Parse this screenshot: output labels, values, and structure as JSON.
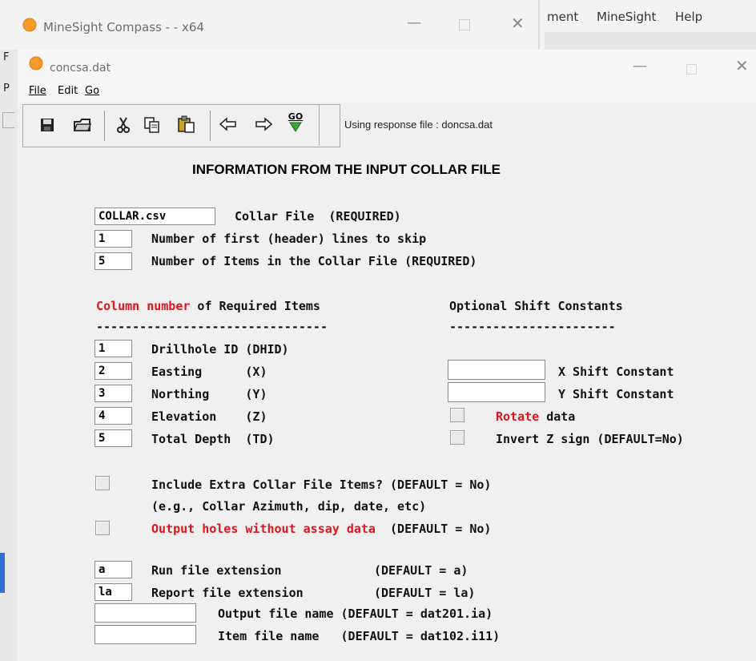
{
  "outer_window": {
    "title": "MineSight Compass - - x64",
    "menu": [
      "ment",
      "MineSight",
      "Help"
    ],
    "left_letters": [
      "F",
      "P"
    ]
  },
  "inner_window": {
    "title": "concsa.dat",
    "menu": [
      "File",
      "Edit",
      "Go"
    ]
  },
  "toolbar": {
    "icons": [
      "save-icon",
      "open-icon",
      "cut-icon",
      "copy-icon",
      "paste-icon",
      "back-arrow-icon",
      "forward-arrow-icon",
      "go-icon"
    ],
    "go_label": "GO",
    "status": "Using response file : doncsa.dat"
  },
  "form": {
    "title": "INFORMATION FROM THE INPUT COLLAR FILE",
    "collar_file": {
      "value": "COLLAR.csv",
      "label": "Collar File  (REQUIRED)"
    },
    "header_skip": {
      "value": "1",
      "label": "Number of first (header) lines to skip"
    },
    "num_items": {
      "value": "5",
      "label": "Number of Items in the Collar File (REQUIRED)"
    },
    "col_heading_red": "Column number",
    "col_heading_rest": " of Required Items",
    "shift_heading": "Optional Shift Constants",
    "dashes_left": "--------------------------------",
    "dashes_right": "-----------------------",
    "columns": [
      {
        "value": "1",
        "label": "Drillhole ID (DHID)"
      },
      {
        "value": "2",
        "label": "Easting      (X)"
      },
      {
        "value": "3",
        "label": "Northing     (Y)"
      },
      {
        "value": "4",
        "label": "Elevation    (Z)"
      },
      {
        "value": "5",
        "label": "Total Depth  (TD)"
      }
    ],
    "x_shift": {
      "value": "",
      "label": "X Shift Constant"
    },
    "y_shift": {
      "value": "",
      "label": "Y Shift Constant"
    },
    "rotate": {
      "checked": false,
      "label_red": "Rotate",
      "label_rest": " data"
    },
    "invert": {
      "checked": false,
      "label": "Invert Z sign (DEFAULT=No)"
    },
    "extra_items": {
      "checked": false,
      "label": "Include Extra Collar File Items? (DEFAULT = No)",
      "note": "(e.g., Collar Azimuth, dip, date, etc)"
    },
    "output_holes": {
      "checked": false,
      "label_red": "Output holes without assay data",
      "label_rest": "  (DEFAULT = No)"
    },
    "run_ext": {
      "value": "a",
      "label": "Run file extension",
      "default": "(DEFAULT = a)"
    },
    "report_ext": {
      "value": "la",
      "label": "Report file extension",
      "default": "(DEFAULT = la)"
    },
    "output_file": {
      "value": "",
      "label": "Output file name (DEFAULT = dat201.ia)"
    },
    "item_file": {
      "value": "",
      "label": "Item file name   (DEFAULT = dat102.i11)"
    }
  }
}
